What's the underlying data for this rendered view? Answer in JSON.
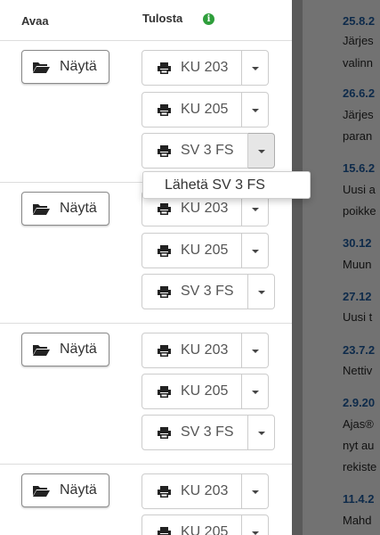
{
  "table": {
    "headers": {
      "open": "Avaa",
      "print": "Tulosta"
    },
    "rows": [
      {
        "show": "Näytä",
        "prints": [
          "KU 203",
          "KU 205",
          "SV 3 FS"
        ]
      },
      {
        "show": "Näytä",
        "prints": [
          "KU 203",
          "KU 205",
          "SV 3 FS"
        ]
      },
      {
        "show": "Näytä",
        "prints": [
          "KU 203",
          "KU 205",
          "SV 3 FS"
        ]
      },
      {
        "show": "Näytä",
        "prints": [
          "KU 203",
          "KU 205"
        ]
      }
    ]
  },
  "dropdown": {
    "item": "Lähetä SV 3 FS"
  },
  "news": {
    "items": [
      {
        "date": "25.8.2",
        "lines": [
          "Järjes",
          "valinn"
        ]
      },
      {
        "date": "26.6.2",
        "lines": [
          "Järjes",
          "paran"
        ]
      },
      {
        "date": "15.6.2",
        "lines": [
          "Uusi a",
          "poikke"
        ]
      },
      {
        "date": "30.12",
        "lines": [
          "Muun"
        ]
      },
      {
        "date": "27.12",
        "lines": [
          "Uusi t"
        ]
      },
      {
        "date": "23.7.2",
        "lines": [
          "Nettiv"
        ]
      },
      {
        "date": "2.9.20",
        "lines": [
          "Ajas®",
          "nyt au",
          "rekiste"
        ]
      },
      {
        "date": "11.4.2",
        "lines": [
          "Mahd"
        ]
      }
    ]
  },
  "colors": {
    "info_icon": "#2e9e3b",
    "news_bg": "#727272",
    "news_date": "#0d2a4a"
  }
}
